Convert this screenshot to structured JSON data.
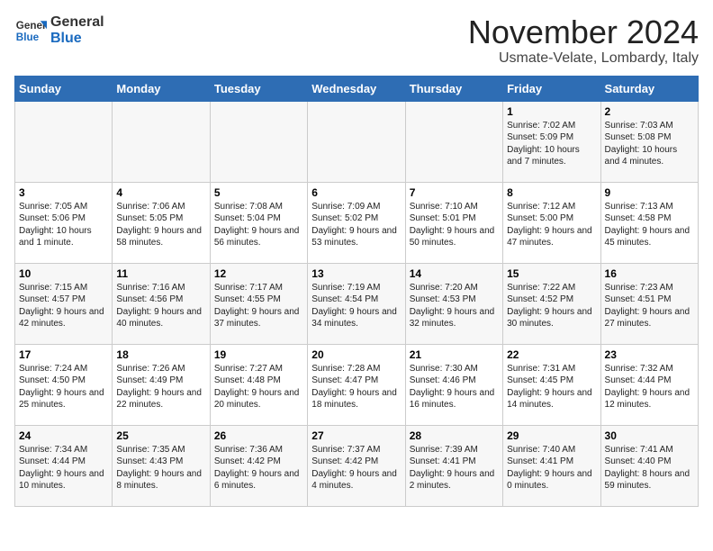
{
  "header": {
    "logo_general": "General",
    "logo_blue": "Blue",
    "month_title": "November 2024",
    "location": "Usmate-Velate, Lombardy, Italy"
  },
  "days_of_week": [
    "Sunday",
    "Monday",
    "Tuesday",
    "Wednesday",
    "Thursday",
    "Friday",
    "Saturday"
  ],
  "weeks": [
    [
      {
        "day": "",
        "info": ""
      },
      {
        "day": "",
        "info": ""
      },
      {
        "day": "",
        "info": ""
      },
      {
        "day": "",
        "info": ""
      },
      {
        "day": "",
        "info": ""
      },
      {
        "day": "1",
        "info": "Sunrise: 7:02 AM\nSunset: 5:09 PM\nDaylight: 10 hours and 7 minutes."
      },
      {
        "day": "2",
        "info": "Sunrise: 7:03 AM\nSunset: 5:08 PM\nDaylight: 10 hours and 4 minutes."
      }
    ],
    [
      {
        "day": "3",
        "info": "Sunrise: 7:05 AM\nSunset: 5:06 PM\nDaylight: 10 hours and 1 minute."
      },
      {
        "day": "4",
        "info": "Sunrise: 7:06 AM\nSunset: 5:05 PM\nDaylight: 9 hours and 58 minutes."
      },
      {
        "day": "5",
        "info": "Sunrise: 7:08 AM\nSunset: 5:04 PM\nDaylight: 9 hours and 56 minutes."
      },
      {
        "day": "6",
        "info": "Sunrise: 7:09 AM\nSunset: 5:02 PM\nDaylight: 9 hours and 53 minutes."
      },
      {
        "day": "7",
        "info": "Sunrise: 7:10 AM\nSunset: 5:01 PM\nDaylight: 9 hours and 50 minutes."
      },
      {
        "day": "8",
        "info": "Sunrise: 7:12 AM\nSunset: 5:00 PM\nDaylight: 9 hours and 47 minutes."
      },
      {
        "day": "9",
        "info": "Sunrise: 7:13 AM\nSunset: 4:58 PM\nDaylight: 9 hours and 45 minutes."
      }
    ],
    [
      {
        "day": "10",
        "info": "Sunrise: 7:15 AM\nSunset: 4:57 PM\nDaylight: 9 hours and 42 minutes."
      },
      {
        "day": "11",
        "info": "Sunrise: 7:16 AM\nSunset: 4:56 PM\nDaylight: 9 hours and 40 minutes."
      },
      {
        "day": "12",
        "info": "Sunrise: 7:17 AM\nSunset: 4:55 PM\nDaylight: 9 hours and 37 minutes."
      },
      {
        "day": "13",
        "info": "Sunrise: 7:19 AM\nSunset: 4:54 PM\nDaylight: 9 hours and 34 minutes."
      },
      {
        "day": "14",
        "info": "Sunrise: 7:20 AM\nSunset: 4:53 PM\nDaylight: 9 hours and 32 minutes."
      },
      {
        "day": "15",
        "info": "Sunrise: 7:22 AM\nSunset: 4:52 PM\nDaylight: 9 hours and 30 minutes."
      },
      {
        "day": "16",
        "info": "Sunrise: 7:23 AM\nSunset: 4:51 PM\nDaylight: 9 hours and 27 minutes."
      }
    ],
    [
      {
        "day": "17",
        "info": "Sunrise: 7:24 AM\nSunset: 4:50 PM\nDaylight: 9 hours and 25 minutes."
      },
      {
        "day": "18",
        "info": "Sunrise: 7:26 AM\nSunset: 4:49 PM\nDaylight: 9 hours and 22 minutes."
      },
      {
        "day": "19",
        "info": "Sunrise: 7:27 AM\nSunset: 4:48 PM\nDaylight: 9 hours and 20 minutes."
      },
      {
        "day": "20",
        "info": "Sunrise: 7:28 AM\nSunset: 4:47 PM\nDaylight: 9 hours and 18 minutes."
      },
      {
        "day": "21",
        "info": "Sunrise: 7:30 AM\nSunset: 4:46 PM\nDaylight: 9 hours and 16 minutes."
      },
      {
        "day": "22",
        "info": "Sunrise: 7:31 AM\nSunset: 4:45 PM\nDaylight: 9 hours and 14 minutes."
      },
      {
        "day": "23",
        "info": "Sunrise: 7:32 AM\nSunset: 4:44 PM\nDaylight: 9 hours and 12 minutes."
      }
    ],
    [
      {
        "day": "24",
        "info": "Sunrise: 7:34 AM\nSunset: 4:44 PM\nDaylight: 9 hours and 10 minutes."
      },
      {
        "day": "25",
        "info": "Sunrise: 7:35 AM\nSunset: 4:43 PM\nDaylight: 9 hours and 8 minutes."
      },
      {
        "day": "26",
        "info": "Sunrise: 7:36 AM\nSunset: 4:42 PM\nDaylight: 9 hours and 6 minutes."
      },
      {
        "day": "27",
        "info": "Sunrise: 7:37 AM\nSunset: 4:42 PM\nDaylight: 9 hours and 4 minutes."
      },
      {
        "day": "28",
        "info": "Sunrise: 7:39 AM\nSunset: 4:41 PM\nDaylight: 9 hours and 2 minutes."
      },
      {
        "day": "29",
        "info": "Sunrise: 7:40 AM\nSunset: 4:41 PM\nDaylight: 9 hours and 0 minutes."
      },
      {
        "day": "30",
        "info": "Sunrise: 7:41 AM\nSunset: 4:40 PM\nDaylight: 8 hours and 59 minutes."
      }
    ]
  ]
}
